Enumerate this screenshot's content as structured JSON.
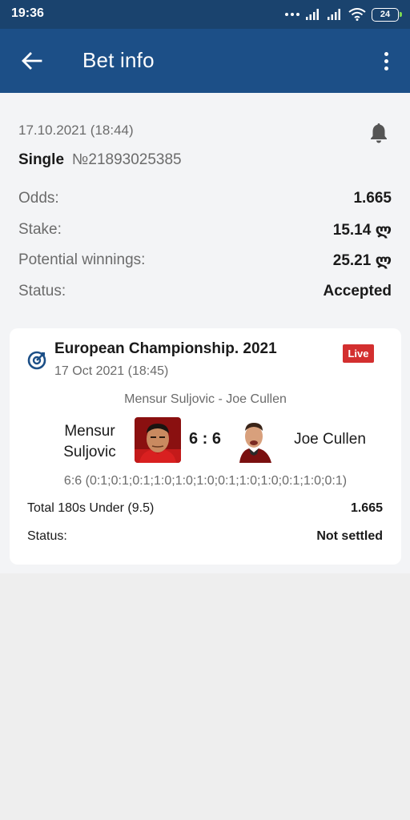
{
  "status_bar": {
    "time": "19:36",
    "battery": "24",
    "icons": [
      "more-dots-icon",
      "signal-icon",
      "signal-icon",
      "wifi-icon",
      "battery-icon"
    ]
  },
  "app_bar": {
    "title": "Bet info",
    "back_icon": "arrow-left-icon",
    "menu_icon": "more-vertical-icon"
  },
  "bet": {
    "date": "17.10.2021 (18:44)",
    "type": "Single",
    "number": "№21893025385",
    "rows": [
      {
        "label": "Odds:",
        "value": "1.665"
      },
      {
        "label": "Stake:",
        "value": "15.14 ლ"
      },
      {
        "label": "Potential winnings:",
        "value": "25.21 ლ"
      },
      {
        "label": "Status:",
        "value": "Accepted"
      }
    ]
  },
  "event": {
    "tournament": "European Championship. 2021",
    "date": "17 Oct 2021 (18:45)",
    "live_label": "Live",
    "match_title": "Mensur Suljovic - Joe Cullen",
    "player1": "Mensur Suljovic",
    "player2": "Joe Cullen",
    "score": "6 : 6",
    "sets": "6:6 (0:1;0:1;0:1;1:0;1:0;1:0;0:1;1:0;1:0;0:1;1:0;0:1)",
    "market": {
      "label": "Total 180s Under (9.5)",
      "value": "1.665"
    },
    "status": {
      "label": "Status:",
      "value": "Not settled"
    }
  },
  "colors": {
    "status_bar": "#1a436e",
    "app_bar": "#1c4f87",
    "live_badge": "#d32f2f",
    "page_background": "#eeeeee"
  }
}
